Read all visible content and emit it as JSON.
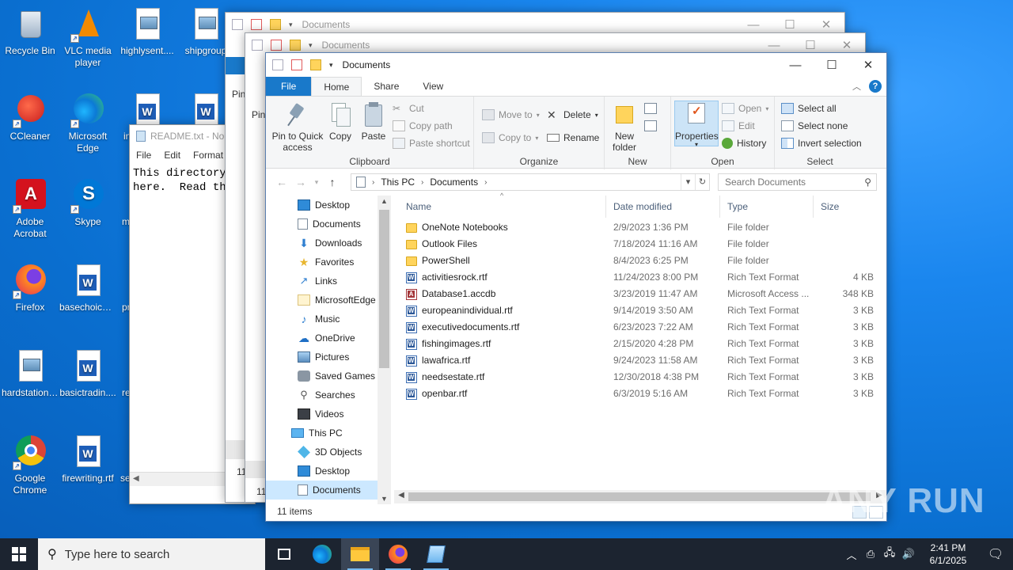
{
  "desktop": {
    "icons": [
      {
        "label": "Recycle Bin"
      },
      {
        "label": "VLC media player"
      },
      {
        "label": "highlysent...."
      },
      {
        "label": "shipgroup"
      },
      {
        "label": "CCleaner"
      },
      {
        "label": "Microsoft Edge"
      },
      {
        "label": "in"
      },
      {
        "label": "Adobe Acrobat"
      },
      {
        "label": "Skype"
      },
      {
        "label": "m"
      },
      {
        "label": "Firefox"
      },
      {
        "label": "basechoice...."
      },
      {
        "label": "pr"
      },
      {
        "label": "hardstation...."
      },
      {
        "label": "basictradin...."
      },
      {
        "label": "re"
      },
      {
        "label": "Google Chrome"
      },
      {
        "label": "firewriting.rtf"
      },
      {
        "label": "se"
      }
    ]
  },
  "notepad": {
    "title": "README.txt - No",
    "menu": [
      "File",
      "Edit",
      "Format"
    ],
    "text": "This directory\nhere.  Read the"
  },
  "bg_windows": {
    "title1": "Documents",
    "title2": "Documents",
    "pin_label1": "Pin",
    "pin_label2": "Pin",
    "status1": "11",
    "status2": "11"
  },
  "explorer": {
    "title": "Documents",
    "tabs": {
      "file": "File",
      "home": "Home",
      "share": "Share",
      "view": "View"
    },
    "ribbon": {
      "pin": "Pin to Quick access",
      "copy": "Copy",
      "paste": "Paste",
      "cut": "Cut",
      "copy_path": "Copy path",
      "paste_shortcut": "Paste shortcut",
      "clipboard": "Clipboard",
      "move_to": "Move to",
      "copy_to": "Copy to",
      "delete": "Delete",
      "rename": "Rename",
      "organize": "Organize",
      "new_folder": "New folder",
      "new": "New",
      "properties": "Properties",
      "open": "Open",
      "edit": "Edit",
      "history": "History",
      "open_group": "Open",
      "select_all": "Select all",
      "select_none": "Select none",
      "invert_selection": "Invert selection",
      "select_group": "Select"
    },
    "address": {
      "this_pc": "This PC",
      "documents": "Documents"
    },
    "search_placeholder": "Search Documents",
    "nav": [
      {
        "label": "Desktop"
      },
      {
        "label": "Documents"
      },
      {
        "label": "Downloads"
      },
      {
        "label": "Favorites"
      },
      {
        "label": "Links"
      },
      {
        "label": "MicrosoftEdge"
      },
      {
        "label": "Music"
      },
      {
        "label": "OneDrive"
      },
      {
        "label": "Pictures"
      },
      {
        "label": "Saved Games"
      },
      {
        "label": "Searches"
      },
      {
        "label": "Videos"
      },
      {
        "label": "This PC"
      },
      {
        "label": "3D Objects"
      },
      {
        "label": "Desktop"
      },
      {
        "label": "Documents"
      }
    ],
    "columns": {
      "name": "Name",
      "date": "Date modified",
      "type": "Type",
      "size": "Size"
    },
    "files": [
      {
        "name": "OneNote Notebooks",
        "date": "2/9/2023 1:36 PM",
        "type": "File folder",
        "size": "",
        "icon": "folder"
      },
      {
        "name": "Outlook Files",
        "date": "7/18/2024 11:16 AM",
        "type": "File folder",
        "size": "",
        "icon": "folder"
      },
      {
        "name": "PowerShell",
        "date": "8/4/2023 6:25 PM",
        "type": "File folder",
        "size": "",
        "icon": "folder"
      },
      {
        "name": "activitiesrock.rtf",
        "date": "11/24/2023 8:00 PM",
        "type": "Rich Text Format",
        "size": "4 KB",
        "icon": "rtf"
      },
      {
        "name": "Database1.accdb",
        "date": "3/23/2019 11:47 AM",
        "type": "Microsoft Access ...",
        "size": "348 KB",
        "icon": "accdb"
      },
      {
        "name": "europeanindividual.rtf",
        "date": "9/14/2019 3:50 AM",
        "type": "Rich Text Format",
        "size": "3 KB",
        "icon": "rtf"
      },
      {
        "name": "executivedocuments.rtf",
        "date": "6/23/2023 7:22 AM",
        "type": "Rich Text Format",
        "size": "3 KB",
        "icon": "rtf"
      },
      {
        "name": "fishingimages.rtf",
        "date": "2/15/2020 4:28 PM",
        "type": "Rich Text Format",
        "size": "3 KB",
        "icon": "rtf"
      },
      {
        "name": "lawafrica.rtf",
        "date": "9/24/2023 11:58 AM",
        "type": "Rich Text Format",
        "size": "3 KB",
        "icon": "rtf"
      },
      {
        "name": "needsestate.rtf",
        "date": "12/30/2018 4:38 PM",
        "type": "Rich Text Format",
        "size": "3 KB",
        "icon": "rtf"
      },
      {
        "name": "openbar.rtf",
        "date": "6/3/2019 5:16 AM",
        "type": "Rich Text Format",
        "size": "3 KB",
        "icon": "rtf"
      }
    ],
    "status": "11 items"
  },
  "taskbar": {
    "search_placeholder": "Type here to search",
    "time": "2:41 PM",
    "date": "6/1/2025"
  },
  "watermark": "ANY RUN"
}
